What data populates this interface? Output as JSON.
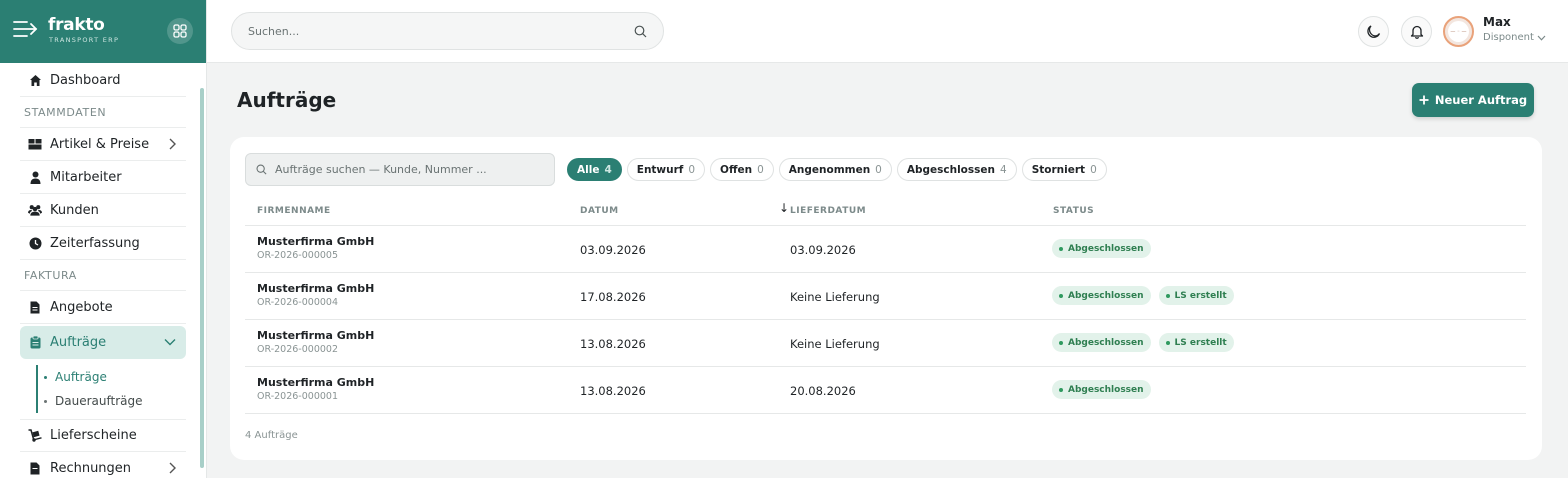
{
  "brand": {
    "name": "frakto",
    "subtitle": "TRANSPORT ERP"
  },
  "sidebar": {
    "items": [
      {
        "label": "Dashboard"
      },
      {
        "section": "STAMMDATEN"
      },
      {
        "label": "Artikel & Preise"
      },
      {
        "label": "Mitarbeiter"
      },
      {
        "label": "Kunden"
      },
      {
        "label": "Zeiterfassung"
      },
      {
        "section": "FAKTURA"
      },
      {
        "label": "Angebote"
      },
      {
        "label": "Aufträge"
      },
      {
        "label": "Lieferscheine"
      },
      {
        "label": "Rechnungen"
      }
    ],
    "sub_items": [
      {
        "label": "Aufträge"
      },
      {
        "label": "Daueraufträge"
      }
    ]
  },
  "topbar": {
    "search_placeholder": "Suchen...",
    "user": {
      "name": "Max",
      "role": "Disponent"
    },
    "avatar_text": "— ◦ —"
  },
  "main": {
    "title": "Aufträge",
    "new_button": "Neuer Auftrag",
    "search_placeholder": "Aufträge suchen — Kunde, Nummer ...",
    "filters": [
      {
        "label": "Alle",
        "count": "4"
      },
      {
        "label": "Entwurf",
        "count": "0"
      },
      {
        "label": "Offen",
        "count": "0"
      },
      {
        "label": "Angenommen",
        "count": "0"
      },
      {
        "label": "Abgeschlossen",
        "count": "4"
      },
      {
        "label": "Storniert",
        "count": "0"
      }
    ],
    "columns": {
      "firm": "FIRMENNAME",
      "date": "DATUM",
      "delivery": "LIEFERDATUM",
      "status": "STATUS"
    },
    "sort_indicator": "↓",
    "rows": [
      {
        "firm": "Musterfirma GmbH",
        "number": "OR-2026-000005",
        "date": "03.09.2026",
        "delivery": "03.09.2026",
        "badges": [
          "Abgeschlossen"
        ]
      },
      {
        "firm": "Musterfirma GmbH",
        "number": "OR-2026-000004",
        "date": "17.08.2026",
        "delivery": "Keine Lieferung",
        "badges": [
          "Abgeschlossen",
          "LS erstellt"
        ]
      },
      {
        "firm": "Musterfirma GmbH",
        "number": "OR-2026-000002",
        "date": "13.08.2026",
        "delivery": "Keine Lieferung",
        "badges": [
          "Abgeschlossen",
          "LS erstellt"
        ]
      },
      {
        "firm": "Musterfirma GmbH",
        "number": "OR-2026-000001",
        "date": "13.08.2026",
        "delivery": "20.08.2026",
        "badges": [
          "Abgeschlossen"
        ]
      }
    ],
    "count_label": "4 Aufträge"
  },
  "colors": {
    "accent": "#2b7f73",
    "badge_bg": "#e2f2ea",
    "badge_text": "#2f7f51"
  }
}
